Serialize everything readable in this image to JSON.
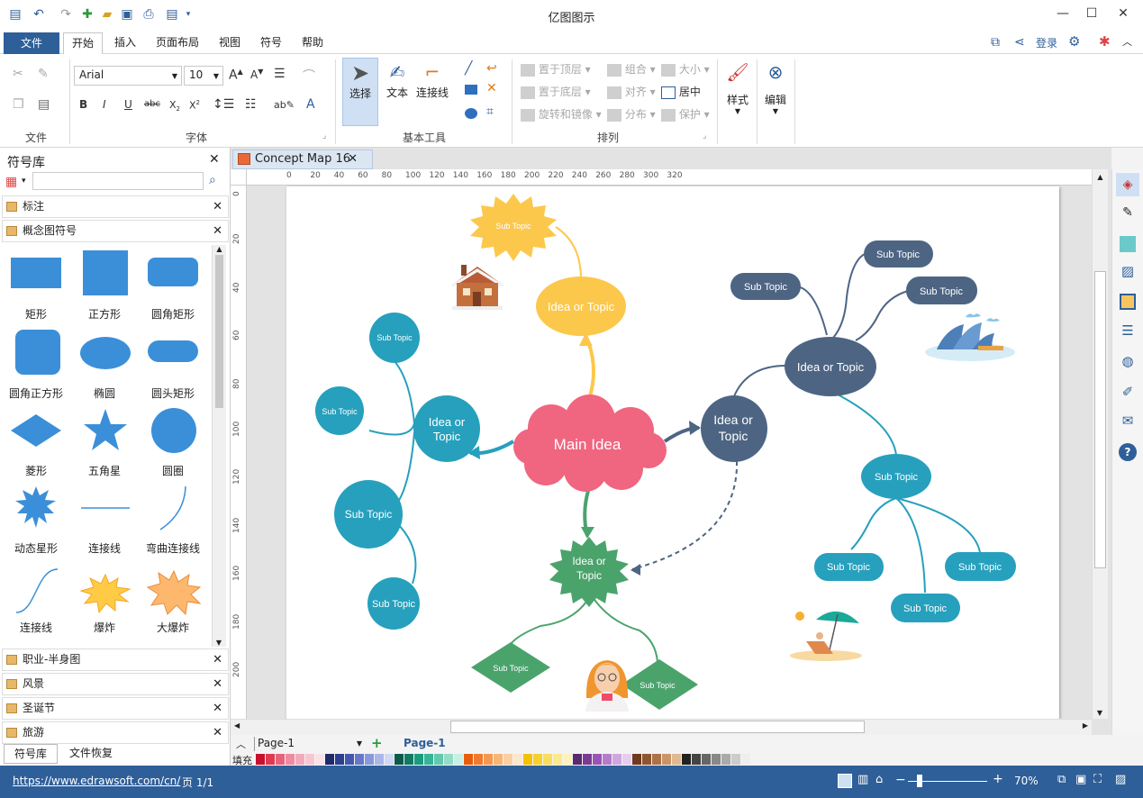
{
  "app": {
    "title": "亿图图示"
  },
  "window": {
    "min": "—",
    "max": "☐",
    "close": "✕",
    "menu": "?"
  },
  "menu": {
    "file": "文件",
    "items": [
      "开始",
      "插入",
      "页面布局",
      "视图",
      "符号",
      "帮助"
    ],
    "login": "登录"
  },
  "ribbon": {
    "groups": {
      "file": "文件",
      "font": "字体",
      "basic_tools": "基本工具",
      "arrange": "排列"
    },
    "font_name": "Arial",
    "font_size": "10",
    "select": "选择",
    "text": "文本",
    "connector": "连接线",
    "arrange_items": {
      "bring_front": "置于顶层",
      "send_back": "置于底层",
      "rotate": "旋转和镜像",
      "group": "组合",
      "align": "对齐",
      "distribute": "分布",
      "size": "大小",
      "center": "居中",
      "protect": "保护"
    },
    "style": "样式",
    "edit": "编辑"
  },
  "sidebar": {
    "title": "符号库",
    "search_placeholder": "",
    "libraries_top": [
      "标注",
      "概念图符号"
    ],
    "shapes": [
      [
        "矩形",
        "正方形",
        "圆角矩形"
      ],
      [
        "圆角正方形",
        "椭圆",
        "圆头矩形"
      ],
      [
        "菱形",
        "五角星",
        "圆圈"
      ],
      [
        "动态星形",
        "连接线",
        "弯曲连接线"
      ],
      [
        "连接线",
        "爆炸",
        "大爆炸"
      ]
    ],
    "libraries_bottom": [
      "职业-半身图",
      "风景",
      "圣诞节",
      "旅游"
    ],
    "tabs": [
      "符号库",
      "文件恢复"
    ]
  },
  "document": {
    "tab": "Concept Map 16"
  },
  "ruler": {
    "h": [
      "0",
      "20",
      "40",
      "60",
      "80",
      "100",
      "120",
      "140",
      "160",
      "180",
      "200",
      "220",
      "240",
      "260",
      "280",
      "300",
      "320"
    ],
    "v": [
      "0",
      "20",
      "40",
      "60",
      "80",
      "100",
      "120",
      "140",
      "160",
      "180",
      "200"
    ]
  },
  "diagram": {
    "main": "Main Idea",
    "idea": "Idea or Topic",
    "idea_left": [
      "Idea or",
      "Topic"
    ],
    "idea_right": [
      "Idea or",
      "Topic"
    ],
    "idea_bottom": [
      "Idea or",
      "Topic"
    ],
    "sub": "Sub Topic"
  },
  "pagebar": {
    "page_select": "Page-1",
    "active_page": "Page-1",
    "fill_label": "填充"
  },
  "status": {
    "url": "https://www.edrawsoft.com/cn/",
    "page": "页 1/1",
    "zoom": "70%"
  },
  "colors": {
    "blue": "#2e5f99",
    "teal": "#26a0bd",
    "navy": "#4d6583",
    "yellow": "#fcc84b",
    "pink": "#f0657f",
    "green": "#4ba36c"
  }
}
